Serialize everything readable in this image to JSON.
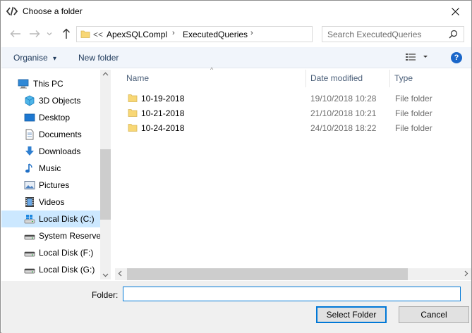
{
  "window": {
    "title": "Choose a folder",
    "close_glyph": "✕"
  },
  "nav": {
    "back_glyph": "←",
    "forward_glyph": "→",
    "recent_glyph": "⌄",
    "up_glyph": "↑",
    "refresh_glyph": "↻"
  },
  "address": {
    "overflow": "<<",
    "path": [
      "ApexSQLCompl",
      "ExecutedQueries"
    ],
    "sep": "›"
  },
  "search": {
    "placeholder": "Search ExecutedQueries"
  },
  "commands": {
    "organise": "Organise",
    "organise_arrow": "▾",
    "new_folder": "New folder",
    "view_arrow": "▾",
    "help": "?"
  },
  "sidebar": {
    "items": [
      {
        "label": "This PC",
        "icon": "computer-icon"
      },
      {
        "label": "3D Objects",
        "icon": "cube-icon"
      },
      {
        "label": "Desktop",
        "icon": "desktop-icon"
      },
      {
        "label": "Documents",
        "icon": "documents-icon"
      },
      {
        "label": "Downloads",
        "icon": "download-icon"
      },
      {
        "label": "Music",
        "icon": "music-icon"
      },
      {
        "label": "Pictures",
        "icon": "pictures-icon"
      },
      {
        "label": "Videos",
        "icon": "videos-icon"
      },
      {
        "label": "Local Disk (C:)",
        "icon": "windows-drive-icon",
        "selected": true
      },
      {
        "label": "System Reservec",
        "icon": "drive-icon"
      },
      {
        "label": "Local Disk (F:)",
        "icon": "drive-icon"
      },
      {
        "label": "Local Disk (G:)",
        "icon": "drive-icon"
      }
    ]
  },
  "list": {
    "columns": [
      "Name",
      "Date modified",
      "Type"
    ],
    "sort_indicator": "^",
    "rows": [
      {
        "name": "10-19-2018",
        "date": "19/10/2018 10:28",
        "type": "File folder"
      },
      {
        "name": "10-21-2018",
        "date": "21/10/2018 10:21",
        "type": "File folder"
      },
      {
        "name": "10-24-2018",
        "date": "24/10/2018 18:22",
        "type": "File folder"
      }
    ]
  },
  "footer": {
    "folder_label": "Folder:",
    "folder_value": "",
    "select_button": "Select Folder",
    "cancel_button": "Cancel"
  },
  "colors": {
    "accent": "#0078d7",
    "selection": "#cce8ff",
    "folder": "#f8d775"
  }
}
